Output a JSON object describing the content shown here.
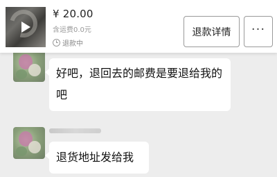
{
  "order": {
    "price": "¥ 20.00",
    "shipping": "含运费0.0元",
    "status": "退款中",
    "refund_details_label": "退款详情",
    "more_label": "···"
  },
  "messages": [
    {
      "text": "好吧，退回去的邮费是要退给我的吧"
    },
    {
      "text": "退货地址发给我"
    }
  ]
}
